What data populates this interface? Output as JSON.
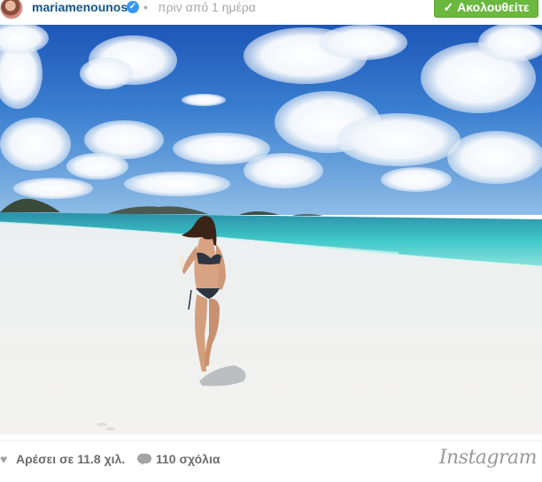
{
  "header": {
    "username": "mariamenounos",
    "verified_symbol": "✓",
    "separator": "•",
    "timestamp": "πριν από 1 ημέρα",
    "follow_check": "✓",
    "follow_label": "Ακολουθείτε"
  },
  "photo": {
    "scene": "beach-bikini-photo"
  },
  "footer": {
    "heart_icon": "♥",
    "likes_label": "Αρέσει σε 11.8 χιλ.",
    "comments_label": "110 σχόλια",
    "logo_text": "Instagram"
  },
  "colors": {
    "username": "#125688",
    "follow_button": "#6bb83f",
    "verified": "#3897f0",
    "meta_gray": "#a5a7aa"
  }
}
